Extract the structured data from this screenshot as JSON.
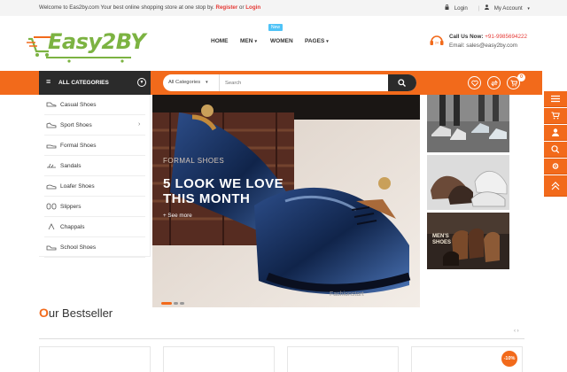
{
  "topbar": {
    "welcome_text": "Welcome to Eas2by.com Your best online shopping store at one stop by.",
    "register": "Register",
    "or": "or",
    "login_link": "Login",
    "login": "Login",
    "account": "My Account"
  },
  "logo": {
    "part1": "Easy",
    "part2": "2BY"
  },
  "nav": {
    "home": "HOME",
    "men": "MEN",
    "women": "WOMEN",
    "pages": "PAGES",
    "new_badge": "New"
  },
  "contact": {
    "call_label": "Call Us Now:",
    "phone": "+91-9985694222",
    "email": "Email: sales@easy2by.com"
  },
  "categories_bar": {
    "label": "ALL CATEGORIES"
  },
  "search": {
    "category": "All Categories",
    "placeholder": "Search"
  },
  "header_icons": {
    "cart_count": "0"
  },
  "sidebar": {
    "items": [
      {
        "label": "Casual Shoes"
      },
      {
        "label": "Sport Shoes"
      },
      {
        "label": "Formal Shoes"
      },
      {
        "label": "Sandals"
      },
      {
        "label": "Loafer Shoes"
      },
      {
        "label": "Slippers"
      },
      {
        "label": "Chappals"
      },
      {
        "label": "School Shoes"
      }
    ]
  },
  "banner": {
    "small_text": "FORMAL SHOES",
    "headline_1": "5 LOOK WE LOVE",
    "headline_2": "THIS MONTH",
    "more": "+ See more",
    "watermark": "Fashionstart"
  },
  "thumbs": {
    "mens_label_1": "MEN'S",
    "mens_label_2": "SHOES"
  },
  "bestseller": {
    "first_letter": "O",
    "rest": "ur Bestseller",
    "pager": "‹ ›",
    "discount": "-10%"
  },
  "colors": {
    "accent": "#f26a1b",
    "dark": "#2b2b2b",
    "logo_green": "#7cb342"
  }
}
